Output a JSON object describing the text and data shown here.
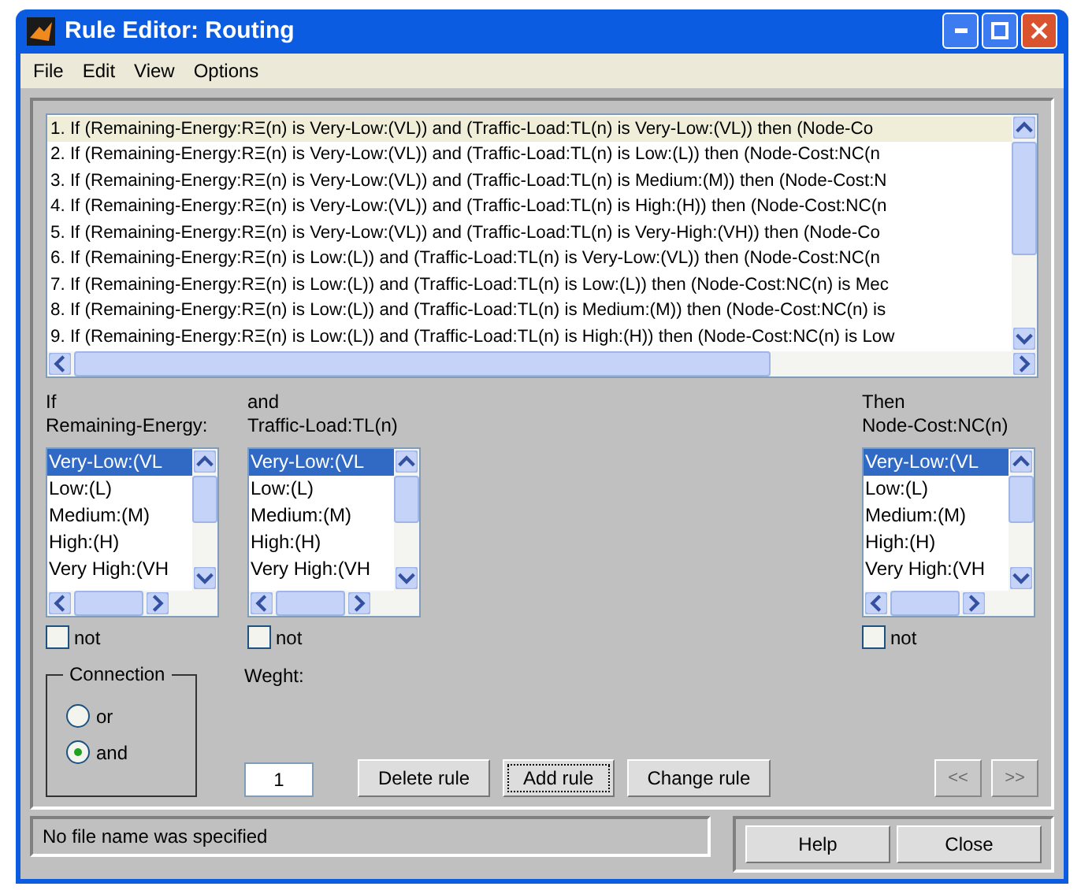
{
  "window": {
    "title": "Rule Editor: Routing"
  },
  "menu": [
    "File",
    "Edit",
    "View",
    "Options"
  ],
  "rules": [
    {
      "text": "1. If (Remaining-Energy:RΞ(n) is Very-Low:(VL)) and (Traffic-Load:TL(n) is Very-Low:(VL)) then (Node-Co",
      "selected": true
    },
    {
      "text": "2. If (Remaining-Energy:RΞ(n) is Very-Low:(VL)) and (Traffic-Load:TL(n) is Low:(L)) then (Node-Cost:NC(n",
      "selected": false
    },
    {
      "text": "3. If (Remaining-Energy:RΞ(n) is Very-Low:(VL)) and (Traffic-Load:TL(n) is Medium:(M)) then (Node-Cost:N",
      "selected": false
    },
    {
      "text": "4. If (Remaining-Energy:RΞ(n) is Very-Low:(VL)) and (Traffic-Load:TL(n) is High:(H)) then (Node-Cost:NC(n",
      "selected": false
    },
    {
      "text": "5. If (Remaining-Energy:RΞ(n) is Very-Low:(VL)) and (Traffic-Load:TL(n) is Very-High:(VH)) then (Node-Co",
      "selected": false
    },
    {
      "text": "6. If (Remaining-Energy:RΞ(n) is Low:(L)) and (Traffic-Load:TL(n) is Very-Low:(VL)) then (Node-Cost:NC(n",
      "selected": false
    },
    {
      "text": "7. If (Remaining-Energy:RΞ(n) is Low:(L)) and (Traffic-Load:TL(n) is Low:(L)) then (Node-Cost:NC(n) is Mec",
      "selected": false
    },
    {
      "text": "8. If (Remaining-Energy:RΞ(n) is Low:(L)) and (Traffic-Load:TL(n) is Medium:(M)) then (Node-Cost:NC(n) is",
      "selected": false
    },
    {
      "text": "9. If (Remaining-Energy:RΞ(n) is Low:(L)) and (Traffic-Load:TL(n) is High:(H)) then (Node-Cost:NC(n) is Low",
      "selected": false
    }
  ],
  "variables": [
    {
      "connective": "If",
      "name": "Remaining-Energy:",
      "items": [
        {
          "label": "Very-Low:(VL",
          "selected": true
        },
        {
          "label": "Low:(L)",
          "selected": false
        },
        {
          "label": "Medium:(M)",
          "selected": false
        },
        {
          "label": "High:(H)",
          "selected": false
        },
        {
          "label": "Very High:(VH",
          "selected": false
        }
      ],
      "not": {
        "label": "not",
        "checked": false
      }
    },
    {
      "connective": "and",
      "name": "Traffic-Load:TL(n)",
      "items": [
        {
          "label": "Very-Low:(VL",
          "selected": true
        },
        {
          "label": "Low:(L)",
          "selected": false
        },
        {
          "label": "Medium:(M)",
          "selected": false
        },
        {
          "label": "High:(H)",
          "selected": false
        },
        {
          "label": "Very High:(VH",
          "selected": false
        }
      ],
      "not": {
        "label": "not",
        "checked": false
      }
    },
    {
      "connective": "Then",
      "name": "Node-Cost:NC(n)",
      "items": [
        {
          "label": "Very-Low:(VL",
          "selected": true
        },
        {
          "label": "Low:(L)",
          "selected": false
        },
        {
          "label": "Medium:(M)",
          "selected": false
        },
        {
          "label": "High:(H)",
          "selected": false
        },
        {
          "label": "Very High:(VH",
          "selected": false
        }
      ],
      "not": {
        "label": "not",
        "checked": false
      }
    }
  ],
  "connection": {
    "title": "Connection",
    "options": [
      {
        "label": "or",
        "selected": false
      },
      {
        "label": "and",
        "selected": true
      }
    ]
  },
  "weight": {
    "label": "Weght:",
    "value": "1"
  },
  "buttons": [
    {
      "label": "Delete rule",
      "focused": false
    },
    {
      "label": "Add rule",
      "focused": true
    },
    {
      "label": "Change rule",
      "focused": false
    }
  ],
  "nav_buttons": [
    {
      "label": "<<",
      "disabled": true
    },
    {
      "label": ">>",
      "disabled": true
    }
  ],
  "status": "No file name was specified",
  "footer_buttons": [
    "Help",
    "Close"
  ]
}
